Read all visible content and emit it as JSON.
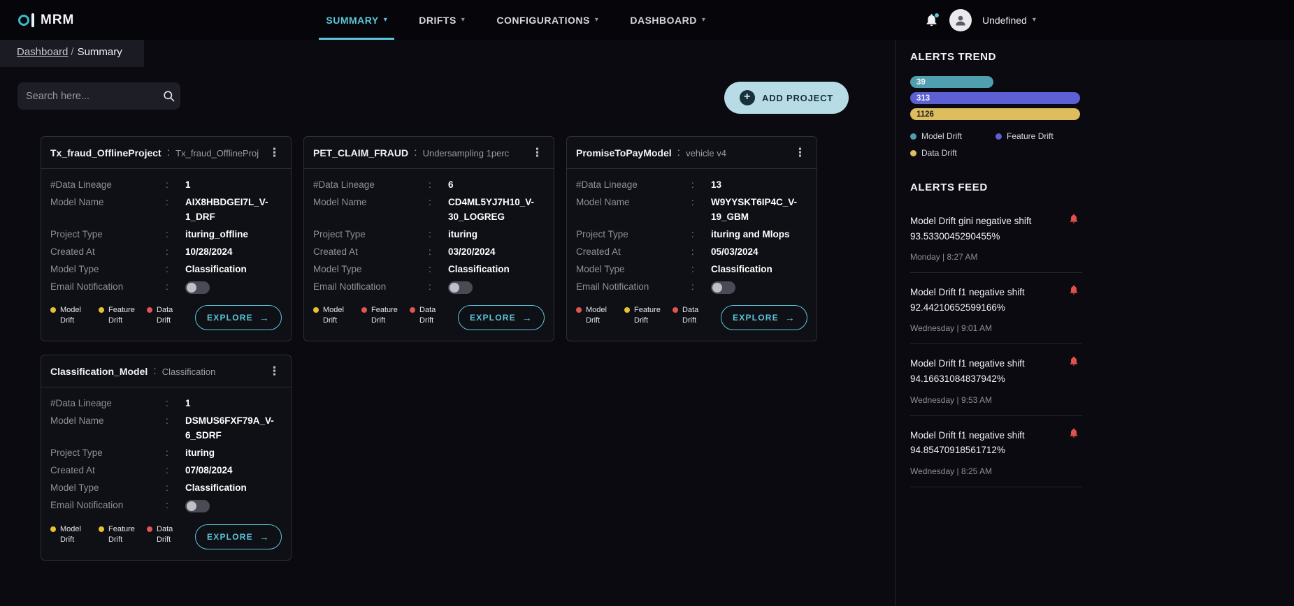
{
  "ui": {
    "colon": ":",
    "kebab_icon": "⋮",
    "caret_icon": "▾",
    "arrow_icon": "→",
    "plus_icon": "+"
  },
  "header": {
    "brand": "MRM",
    "nav": [
      {
        "label": "SUMMARY",
        "active": true
      },
      {
        "label": "DRIFTS",
        "active": false
      },
      {
        "label": "CONFIGURATIONS",
        "active": false
      },
      {
        "label": "DASHBOARD",
        "active": false
      }
    ],
    "user_name": "Undefined"
  },
  "breadcrumb": {
    "parent": "Dashboard",
    "separator": "/",
    "current": "Summary"
  },
  "toolbar": {
    "search_placeholder": "Search here...",
    "add_project_label": "ADD PROJECT"
  },
  "cards": [
    {
      "title": "Tx_fraud_OfflineProject",
      "subtitle": "Tx_fraud_OfflineProj",
      "fields": [
        {
          "label": "#Data Lineage",
          "value": "1"
        },
        {
          "label": "Model Name",
          "value": "AIX8HBDGEI7L_V-1_DRF"
        },
        {
          "label": "Project Type",
          "value": "ituring_offline"
        },
        {
          "label": "Created At",
          "value": "10/28/2024"
        },
        {
          "label": "Model Type",
          "value": "Classification"
        }
      ],
      "email_notification_label": "Email Notification",
      "email_notification_on": false,
      "drifts": [
        {
          "label": "Model Drift",
          "color": "#e7c22e"
        },
        {
          "label": "Feature Drift",
          "color": "#e7c22e"
        },
        {
          "label": "Data Drift",
          "color": "#e25550"
        }
      ],
      "explore_label": "EXPLORE"
    },
    {
      "title": "PET_CLAIM_FRAUD",
      "subtitle": "Undersampling 1perc",
      "fields": [
        {
          "label": "#Data Lineage",
          "value": "6"
        },
        {
          "label": "Model Name",
          "value": "CD4ML5YJ7H10_V-30_LOGREG"
        },
        {
          "label": "Project Type",
          "value": "ituring"
        },
        {
          "label": "Created At",
          "value": "03/20/2024"
        },
        {
          "label": "Model Type",
          "value": "Classification"
        }
      ],
      "email_notification_label": "Email Notification",
      "email_notification_on": false,
      "drifts": [
        {
          "label": "Model Drift",
          "color": "#e7c22e"
        },
        {
          "label": "Feature Drift",
          "color": "#e25550"
        },
        {
          "label": "Data Drift",
          "color": "#e25550"
        }
      ],
      "explore_label": "EXPLORE"
    },
    {
      "title": "PromiseToPayModel",
      "subtitle": "vehicle v4",
      "fields": [
        {
          "label": "#Data Lineage",
          "value": "13"
        },
        {
          "label": "Model Name",
          "value": "W9YYSKT6IP4C_V-19_GBM"
        },
        {
          "label": "Project Type",
          "value": "ituring and Mlops"
        },
        {
          "label": "Created At",
          "value": "05/03/2024"
        },
        {
          "label": "Model Type",
          "value": "Classification"
        }
      ],
      "email_notification_label": "Email Notification",
      "email_notification_on": false,
      "drifts": [
        {
          "label": "Model Drift",
          "color": "#e25550"
        },
        {
          "label": "Feature Drift",
          "color": "#e7c22e"
        },
        {
          "label": "Data Drift",
          "color": "#e25550"
        }
      ],
      "explore_label": "EXPLORE"
    },
    {
      "title": "Classification_Model",
      "subtitle": "Classification",
      "fields": [
        {
          "label": "#Data Lineage",
          "value": "1"
        },
        {
          "label": "Model Name",
          "value": "DSMUS6FXF79A_V-6_SDRF"
        },
        {
          "label": "Project Type",
          "value": "ituring"
        },
        {
          "label": "Created At",
          "value": "07/08/2024"
        },
        {
          "label": "Model Type",
          "value": "Classification"
        }
      ],
      "email_notification_label": "Email Notification",
      "email_notification_on": false,
      "drifts": [
        {
          "label": "Model Drift",
          "color": "#e7c22e"
        },
        {
          "label": "Feature Drift",
          "color": "#e7c22e"
        },
        {
          "label": "Data Drift",
          "color": "#e25550"
        }
      ],
      "explore_label": "EXPLORE"
    }
  ],
  "alerts_trend": {
    "title": "ALERTS TREND",
    "chart_type": "bar",
    "bars": [
      {
        "label": "Model Drift",
        "value": "39",
        "width": "49%",
        "color": "#4f9fae",
        "text_color": "#f2f2f5"
      },
      {
        "label": "Feature Drift",
        "value": "313",
        "width": "100%",
        "color": "#5d5fd4",
        "text_color": "#f2f2f5"
      },
      {
        "label": "Data Drift",
        "value": "1126",
        "width": "100%",
        "color": "#ddbd5d",
        "text_color": "#20202a"
      }
    ],
    "legend": [
      {
        "label": "Model Drift",
        "color": "#4f9fae"
      },
      {
        "label": "Feature Drift",
        "color": "#5d5fd4"
      },
      {
        "label": "Data Drift",
        "color": "#ddbd5d"
      }
    ]
  },
  "alerts_feed": {
    "title": "ALERTS FEED",
    "items": [
      {
        "title": "Model Drift gini negative shift 93.5330045290455%",
        "time": "Monday | 8:27 AM"
      },
      {
        "title": "Model Drift f1 negative shift 92.44210652599166%",
        "time": "Wednesday | 9:01 AM"
      },
      {
        "title": "Model Drift f1 negative shift 94.16631084837942%",
        "time": "Wednesday | 9:53 AM"
      },
      {
        "title": "Model Drift f1 negative shift 94.85470918561712%",
        "time": "Wednesday | 8:25 AM"
      }
    ]
  }
}
